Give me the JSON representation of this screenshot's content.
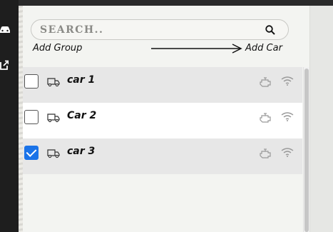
{
  "search": {
    "placeholder": "SEARCH..",
    "icon": "search-icon"
  },
  "actions": {
    "add_group": "Add Group",
    "add_car": "Add Car"
  },
  "cars": [
    {
      "name": "car 1",
      "checked": false
    },
    {
      "name": "Car 2",
      "checked": false
    },
    {
      "name": "car 3",
      "checked": true
    }
  ],
  "colors": {
    "checkbox_accent": "#1a73e8",
    "row_shaded": "#e7e7e7",
    "sidebar": "#1e1e1e"
  },
  "icons": {
    "row_vehicle": "truck-icon",
    "row_engine": "engine-icon",
    "row_signal": "wifi-icon",
    "sidebar": [
      "car-icon",
      "external-link-icon"
    ]
  }
}
